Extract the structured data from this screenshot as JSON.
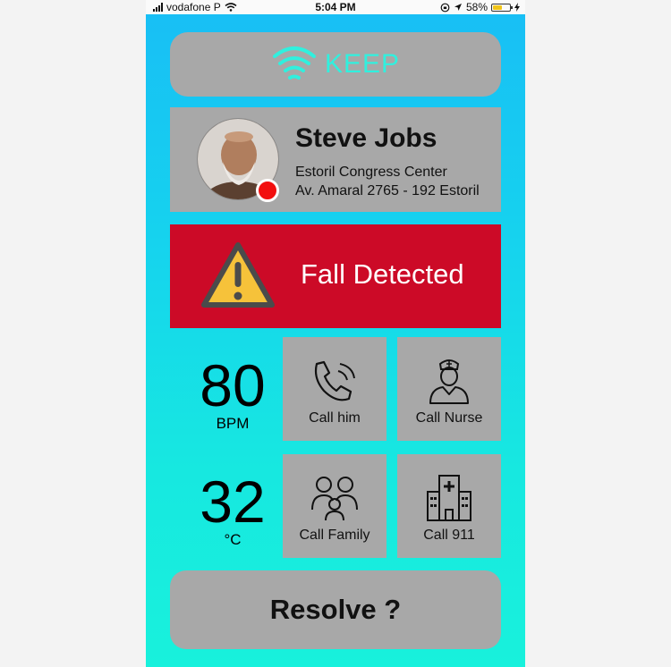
{
  "status_bar": {
    "carrier": "vodafone P",
    "time": "5:04 PM",
    "battery": "58%",
    "battery_level": 0.58
  },
  "app": {
    "brand": "KEEP",
    "brand_color": "#30f0de"
  },
  "patient": {
    "name": "Steve Jobs",
    "location_line1": "Estoril Congress Center",
    "location_line2": "Av. Amaral 2765 - 192 Estoril",
    "status_color": "#f20f0f"
  },
  "alert": {
    "text": "Fall Detected",
    "color": "#cc0a27"
  },
  "vitals": {
    "heart_rate": {
      "value": "80",
      "unit": "BPM"
    },
    "temperature": {
      "value": "32",
      "unit": "°C"
    }
  },
  "actions": [
    {
      "label": "Call him",
      "icon": "phone-icon"
    },
    {
      "label": "Call Nurse",
      "icon": "nurse-icon"
    },
    {
      "label": "Call Family",
      "icon": "family-icon"
    },
    {
      "label": "Call 911",
      "icon": "hospital-icon"
    }
  ],
  "resolve": {
    "label": "Resolve ?"
  }
}
